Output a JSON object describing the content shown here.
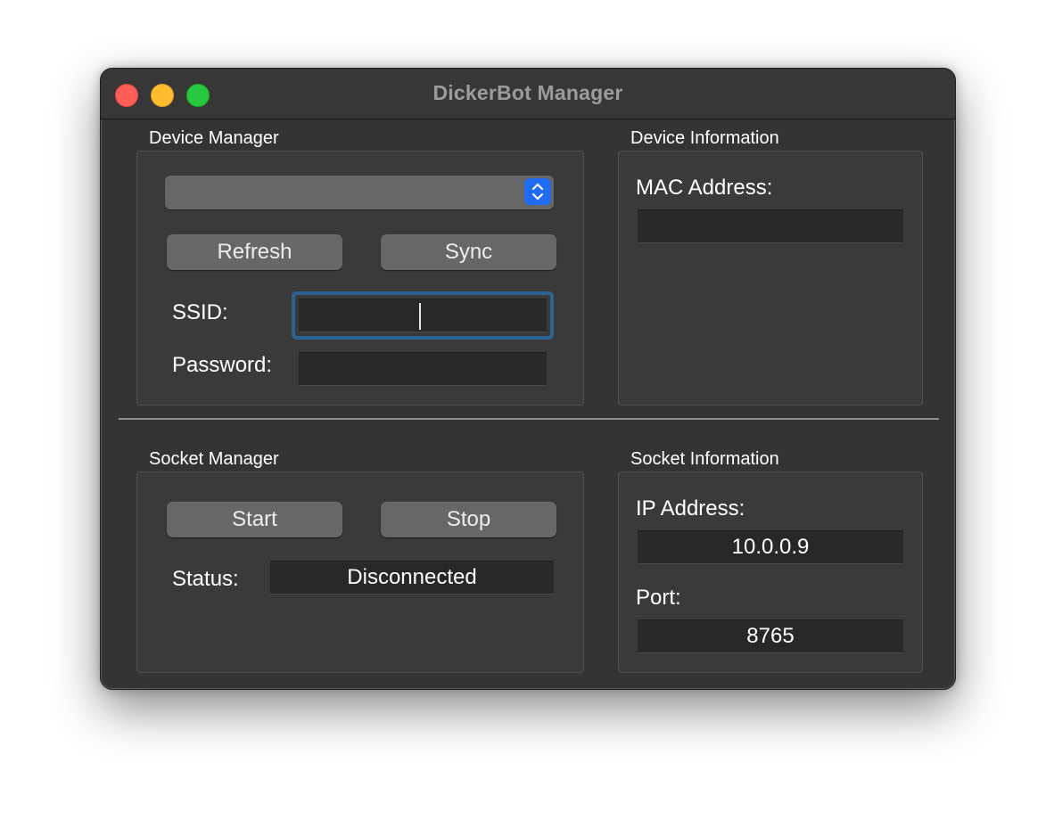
{
  "window": {
    "title": "DickerBot Manager"
  },
  "device_manager": {
    "group_title": "Device Manager",
    "device_select_value": "",
    "refresh_label": "Refresh",
    "sync_label": "Sync",
    "ssid_label": "SSID:",
    "ssid_value": "",
    "password_label": "Password:",
    "password_value": ""
  },
  "device_information": {
    "group_title": "Device Information",
    "mac_label": "MAC Address:",
    "mac_value": ""
  },
  "socket_manager": {
    "group_title": "Socket Manager",
    "start_label": "Start",
    "stop_label": "Stop",
    "status_label": "Status:",
    "status_value": "Disconnected"
  },
  "socket_information": {
    "group_title": "Socket Information",
    "ip_label": "IP Address:",
    "ip_value": "10.0.0.9",
    "port_label": "Port:",
    "port_value": "8765"
  },
  "colors": {
    "window_bg": "#343434",
    "focus_ring": "#2a6394",
    "popup_arrow": "#1f6cf0",
    "close": "#ff5f57",
    "minimize": "#febc2e",
    "zoom": "#28c840"
  },
  "icons": {
    "popup_indicator": "up-down-chevron-icon"
  }
}
